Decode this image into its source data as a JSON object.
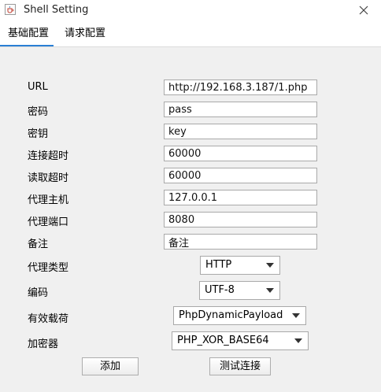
{
  "window": {
    "title": "Shell Setting"
  },
  "tabs": [
    {
      "label": "基础配置",
      "active": true
    },
    {
      "label": "请求配置",
      "active": false
    }
  ],
  "fields": [
    {
      "label": "URL",
      "value": "http://192.168.3.187/1.php"
    },
    {
      "label": "密码",
      "value": "pass"
    },
    {
      "label": "密钥",
      "value": "key"
    },
    {
      "label": "连接超时",
      "value": "60000"
    },
    {
      "label": "读取超时",
      "value": "60000"
    },
    {
      "label": "代理主机",
      "value": "127.0.0.1"
    },
    {
      "label": "代理端口",
      "value": "8080"
    },
    {
      "label": "备注",
      "value": "备注"
    }
  ],
  "selects": [
    {
      "label": "代理类型",
      "value": "HTTP"
    },
    {
      "label": "编码",
      "value": "UTF-8"
    },
    {
      "label": "有效载荷",
      "value": "PhpDynamicPayload"
    },
    {
      "label": "加密器",
      "value": "PHP_XOR_BASE64"
    }
  ],
  "buttons": {
    "add": "添加",
    "test": "测试连接"
  },
  "colors": {
    "tab_accent": "#2a7fd4",
    "background": "#f0f0f0"
  },
  "icons": {
    "app": "java-cup-icon",
    "close": "close-icon",
    "dropdown": "chevron-down-icon"
  }
}
